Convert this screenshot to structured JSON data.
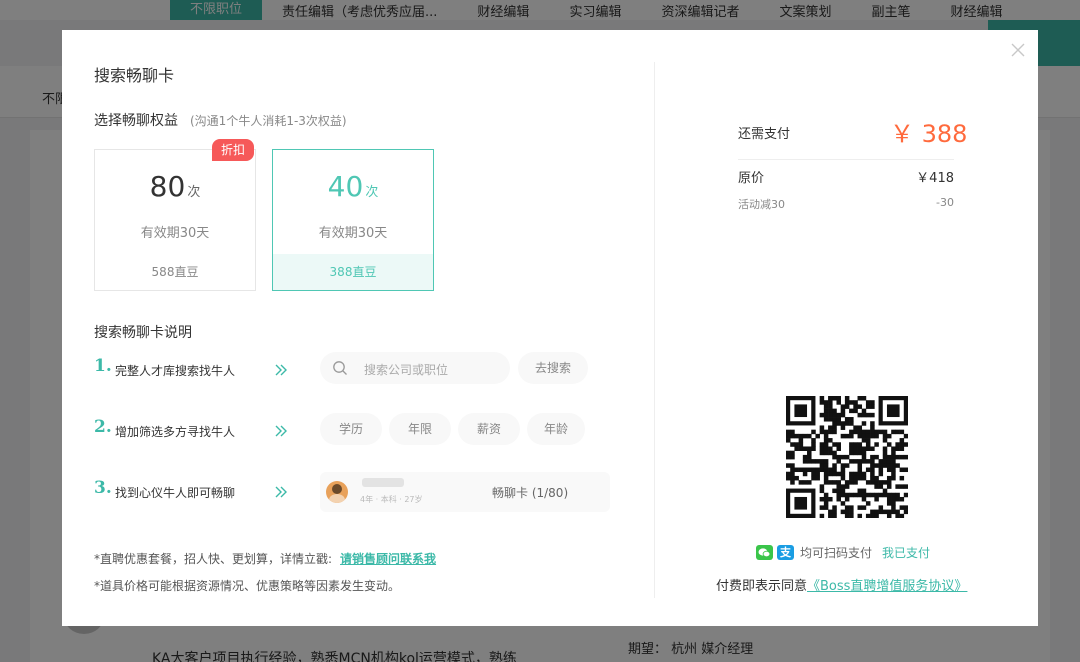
{
  "background": {
    "tabs": [
      "不限职位",
      "责任编辑（考虑优秀应届...",
      "财经编辑",
      "实习编辑",
      "资深编辑记者",
      "文案策划",
      "副主笔",
      "财经编辑"
    ],
    "filter_text": "不限",
    "bottom_line1": "期望：  杭州  媒介经理",
    "bottom_line2": "KA大客户项目执行经验，熟悉MCN机构kol运营模式，熟练"
  },
  "modal": {
    "title": "搜索畅聊卡",
    "section_title": "选择畅聊权益",
    "section_hint": "(沟通1个牛人消耗1-3次权益)",
    "plans": [
      {
        "count": "80",
        "unit": "次",
        "valid": "有效期30天",
        "price": "588直豆",
        "badge": "折扣",
        "selected": false
      },
      {
        "count": "40",
        "unit": "次",
        "valid": "有效期30天",
        "price": "388直豆",
        "selected": true
      }
    ],
    "desc_title": "搜索畅聊卡说明",
    "steps": [
      {
        "num": "1.",
        "label": "完整人才库搜索找牛人",
        "search_placeholder": "搜索公司或职位",
        "search_button": "去搜索"
      },
      {
        "num": "2.",
        "label": "增加筛选多方寻找牛人",
        "chips": [
          "学历",
          "年限",
          "薪资",
          "年龄"
        ]
      },
      {
        "num": "3.",
        "label": "找到心仪牛人即可畅聊",
        "card_info": "4年 · 本科 · 27岁",
        "card_chat": "畅聊卡 (1/80)"
      }
    ],
    "note1": "*直聘优惠套餐，招人快、更划算，详情立戳:",
    "note1_link": "请销售顾问联系我",
    "note2": "*道具价格可能根据资源情况、优惠策略等因素发生变动。",
    "payment": {
      "due_label": "还需支付",
      "due_amount": "￥ 388",
      "original_label": "原价",
      "original_value": "￥418",
      "discount_label": "活动减30",
      "discount_value": "-30",
      "alipay_glyph": "支",
      "scan_text": "均可扫码支付",
      "paid_link": "我已支付",
      "agree_text": "付费即表示同意",
      "agree_link": "《Boss直聘增值服务协议》"
    }
  },
  "colors": {
    "accent": "#3cb9a8",
    "price": "#ff6a3d",
    "badge": "#f65959"
  }
}
